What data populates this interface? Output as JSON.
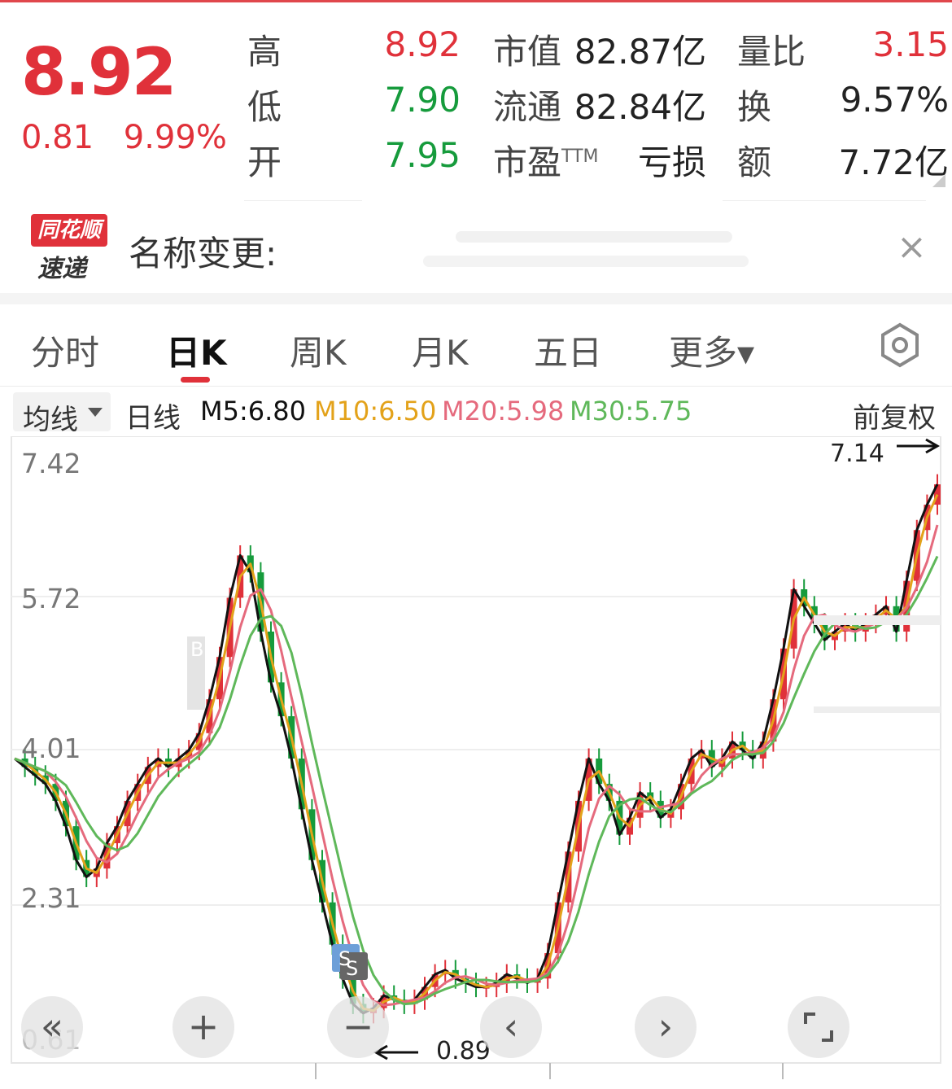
{
  "quote": {
    "price": "8.92",
    "change": "0.81",
    "change_pct": "9.99%",
    "high_label": "高",
    "high_value": "8.92",
    "low_label": "低",
    "low_value": "7.90",
    "open_label": "开",
    "open_value": "7.95",
    "mktcap_label": "市值",
    "mktcap_value": "82.87亿",
    "float_label": "流通",
    "float_value": "82.84亿",
    "pe_label": "市盈",
    "pe_sup": "TTM",
    "pe_value": "亏损",
    "volratio_label": "量比",
    "volratio_value": "3.15",
    "turnover_label": "换",
    "turnover_value": "9.57%",
    "amount_label": "额",
    "amount_value": "7.72亿"
  },
  "news": {
    "logo_top": "同花顺",
    "logo_bottom": "速递",
    "text": "名称变更:",
    "close_glyph": "×"
  },
  "tabs": [
    {
      "label": "分时",
      "active": false
    },
    {
      "label": "日K",
      "active": true
    },
    {
      "label": "周K",
      "active": false
    },
    {
      "label": "月K",
      "active": false
    },
    {
      "label": "五日",
      "active": false
    },
    {
      "label": "更多▾",
      "active": false
    }
  ],
  "ma_bar": {
    "selector": "均线",
    "period": "日线",
    "m5": "M5:6.80",
    "m10": "M10:6.50",
    "m20": "M20:5.98",
    "m30": "M30:5.75",
    "adjust": "前复权"
  },
  "colors": {
    "up": "#e0313a",
    "down": "#169b3c",
    "m5": "#111111",
    "m10": "#e3a21a",
    "m20": "#e56a7d",
    "m30": "#5fb85a"
  },
  "chart": {
    "y_ticks": [
      "7.42",
      "5.72",
      "4.01",
      "2.31",
      "0.61"
    ],
    "markers": [
      "B",
      "S",
      "S"
    ],
    "high_annotation": "7.14",
    "low_annotation": "0.89"
  },
  "controls": {
    "rewind": "«",
    "zoom_in": "+",
    "zoom_out": "−",
    "prev": "‹",
    "next": "›"
  },
  "chart_data": {
    "type": "line",
    "ylim": [
      0.61,
      7.42
    ],
    "series_m5": [
      3.9,
      3.8,
      3.7,
      3.6,
      3.4,
      3.1,
      2.7,
      2.5,
      2.6,
      2.9,
      3.1,
      3.4,
      3.6,
      3.8,
      3.9,
      3.8,
      3.9,
      4.0,
      4.2,
      4.6,
      5.1,
      5.8,
      6.3,
      6.1,
      5.4,
      4.8,
      4.4,
      3.9,
      3.3,
      2.7,
      2.2,
      1.7,
      1.3,
      1.0,
      0.89,
      0.95,
      1.1,
      1.05,
      1.0,
      1.05,
      1.2,
      1.35,
      1.4,
      1.3,
      1.25,
      1.2,
      1.2,
      1.25,
      1.35,
      1.3,
      1.25,
      1.3,
      1.6,
      2.2,
      2.8,
      3.4,
      3.9,
      3.6,
      3.4,
      3.0,
      3.2,
      3.5,
      3.4,
      3.2,
      3.3,
      3.6,
      3.9,
      4.0,
      3.8,
      3.9,
      4.1,
      4.0,
      3.9,
      4.1,
      4.6,
      5.2,
      5.9,
      5.7,
      5.5,
      5.3,
      5.4,
      5.5,
      5.4,
      5.5,
      5.6,
      5.7,
      5.4,
      6.0,
      6.6,
      6.9,
      7.14
    ]
  }
}
